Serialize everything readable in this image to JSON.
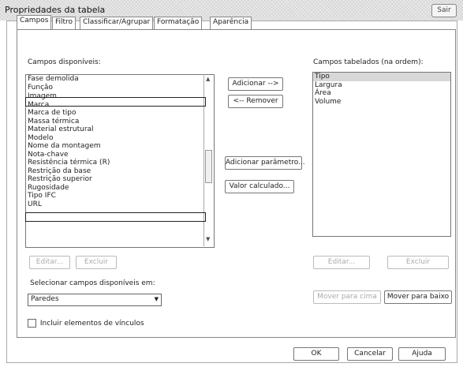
{
  "window": {
    "title": "Propriedades da tabela",
    "close_label": "Sair"
  },
  "tabs": [
    {
      "label": "Campos",
      "active": true
    },
    {
      "label": "Filtro",
      "active": false
    },
    {
      "label": "Classificar/Agrupar",
      "active": false
    },
    {
      "label": "Formatação",
      "active": false
    },
    {
      "label": "Aparência",
      "active": false
    }
  ],
  "available": {
    "label": "Campos disponíveis:",
    "items": [
      "Fase demolida",
      "Função",
      "Imagem",
      "Marca",
      "Marca de tipo",
      "Massa térmica",
      "Material estrutural",
      "Modelo",
      "Nome da montagem",
      "Nota-chave",
      "Resistência térmica (R)",
      "Restrição da base",
      "Restrição superior",
      "Rugosidade",
      "Tipo IFC",
      "URL"
    ]
  },
  "scheduled": {
    "label": "Campos tabelados (na ordem):",
    "items": [
      "Tipo",
      "Largura",
      "Área",
      "Volume"
    ]
  },
  "buttons": {
    "add": "Adicionar -->",
    "remove": "<-- Remover",
    "add_param": "Adicionar parâmetro...",
    "calc_value": "Valor calculado...",
    "edit_left": "Editar...",
    "delete_left": "Excluir",
    "edit_right": "Editar...",
    "delete_right": "Excluir",
    "move_up": "Mover para cima",
    "move_down": "Mover para baixo",
    "ok": "OK",
    "cancel": "Cancelar",
    "help": "Ajuda"
  },
  "select_from": {
    "label": "Selecionar campos disponíveis em:",
    "value": "Paredes"
  },
  "include_links": {
    "label": "Incluir elementos de vínculos",
    "checked": false
  }
}
